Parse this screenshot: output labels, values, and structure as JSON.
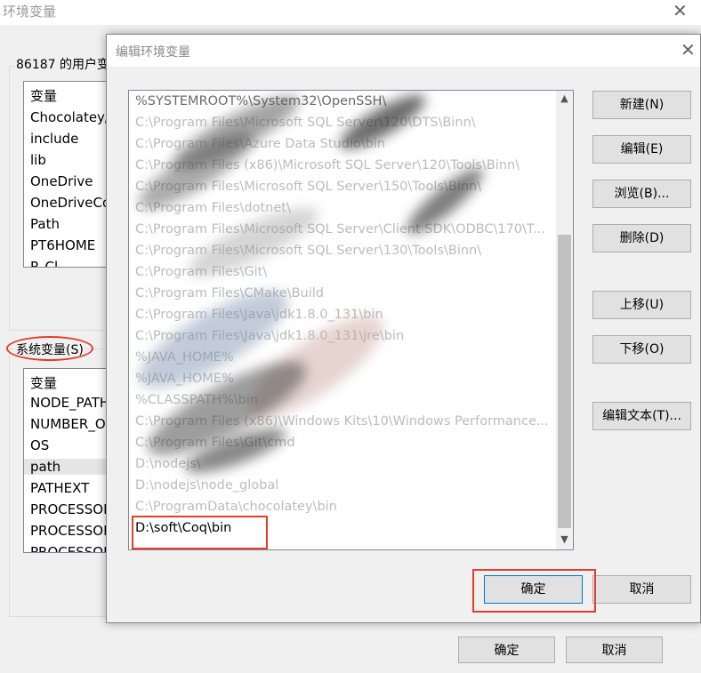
{
  "background_window": {
    "title": "环境变量",
    "user_group_label": "86187 的用户变",
    "user_list": {
      "header": "变量",
      "items": [
        "Chocolatey/",
        "include",
        "lib",
        "OneDrive",
        "OneDriveCo",
        "Path",
        "PT6HOME",
        "P_Cl"
      ]
    },
    "system_group_label": "系统变量(S)",
    "system_list": {
      "header": "变量",
      "items": [
        "NODE_PATH",
        "NUMBER_OI",
        "OS",
        "path",
        "PATHEXT",
        "PROCESSOR",
        "PROCESSOR",
        "PROCESSOR"
      ],
      "selected_index": 3
    },
    "ok_label": "确定",
    "cancel_label": "取消"
  },
  "dialog": {
    "title": "编辑环境变量",
    "entries": [
      "%SYSTEMROOT%\\System32\\OpenSSH\\",
      "C:\\Program Files\\Microsoft SQL Server\\120\\DTS\\Binn\\",
      "C:\\Program Files\\Azure Data Studio\\bin",
      "C:\\Program Files (x86)\\Microsoft SQL Server\\120\\Tools\\Binn\\",
      "C:\\Program Files\\Microsoft SQL Server\\150\\Tools\\Binn\\",
      "C:\\Program Files\\dotnet\\",
      "C:\\Program Files\\Microsoft SQL Server\\Client SDK\\ODBC\\170\\T...",
      "C:\\Program Files\\Microsoft SQL Server\\130\\Tools\\Binn\\",
      "C:\\Program Files\\Git\\",
      "C:\\Program Files\\CMake\\Build",
      "C:\\Program Files\\Java\\jdk1.8.0_131\\bin",
      "C:\\Program Files\\Java\\jdk1.8.0_131\\jre\\bin",
      "%JAVA_HOME%",
      "%JAVA_HOME%",
      "%CLASSPATH%\\bin",
      "C:\\Program Files (x86)\\Windows Kits\\10\\Windows Performance...",
      "C:\\Program Files\\Git\\cmd",
      "D:\\nodejs\\",
      "D:\\nodejs\\node_global",
      "C:\\ProgramData\\chocolatey\\bin",
      "D:\\soft\\Coq\\bin"
    ],
    "buttons": {
      "new": "新建(N)",
      "edit": "编辑(E)",
      "browse": "浏览(B)...",
      "delete": "删除(D)",
      "move_up": "上移(U)",
      "move_down": "下移(O)",
      "edit_text": "编辑文本(T)...",
      "ok": "确定",
      "cancel": "取消"
    }
  },
  "colors": {
    "annotation": "#e53d2c",
    "default_button_border": "#0078d7"
  },
  "icons": [
    "close-icon",
    "scroll-up-icon",
    "scroll-down-icon"
  ]
}
